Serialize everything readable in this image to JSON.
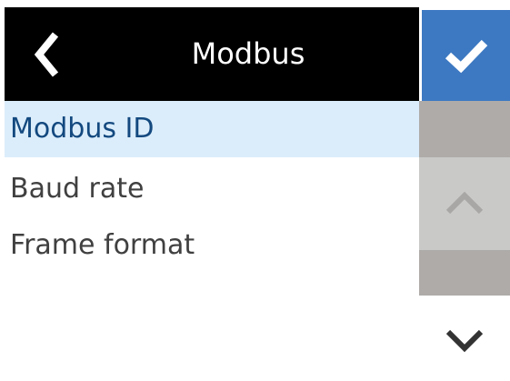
{
  "header": {
    "title": "Modbus",
    "back_icon": "chevron-left-icon",
    "confirm_icon": "checkmark-icon"
  },
  "menu": {
    "items": [
      {
        "label": "Modbus ID",
        "selected": true
      },
      {
        "label": "Baud rate",
        "selected": false
      },
      {
        "label": "Frame format",
        "selected": false
      }
    ]
  },
  "scrollbar": {
    "up_icon": "chevron-up-icon",
    "down_icon": "chevron-down-icon"
  },
  "colors": {
    "header_background": "#000000",
    "confirm_background": "#3d79c2",
    "selected_row_background": "#dbedfb",
    "selected_row_text": "#13497f",
    "item_text": "#404040",
    "scroll_track": "#aeaba9",
    "scroll_button_disabled": "#c9c9c7",
    "scroll_button_active": "#ffffff"
  }
}
